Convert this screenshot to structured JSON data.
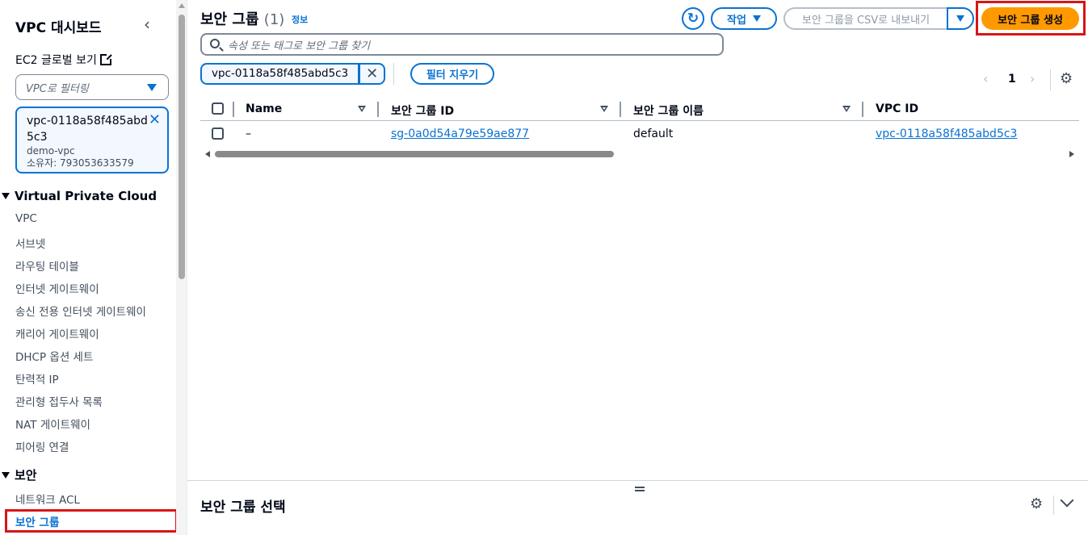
{
  "sidebar": {
    "title": "VPC 대시보드",
    "collapse_icon": "‹",
    "ec2_link": "EC2 글로벌 보기",
    "filter_placeholder": "VPC로 필터링",
    "selected_vpc": {
      "id": "vpc-0118a58f485abd5c3",
      "name": "demo-vpc",
      "owner": "소유자: 793053633579"
    },
    "section_vpc": "Virtual Private Cloud",
    "vpc_items": [
      "VPC",
      "서브넷",
      "라우팅 테이블",
      "인터넷 게이트웨이",
      "송신 전용 인터넷 게이트웨이",
      "캐리어 게이트웨이",
      "DHCP 옵션 세트",
      "탄력적 IP",
      "관리형 접두사 목록",
      "NAT 게이트웨이",
      "피어링 연결"
    ],
    "section_security": "보안",
    "security_items": [
      "네트워크 ACL",
      "보안 그룹"
    ]
  },
  "header": {
    "title": "보안 그룹",
    "count": "(1)",
    "info": "정보",
    "action_label": "작업",
    "export_label": "보안 그룹을 CSV로 내보내기",
    "create_label": "보안 그룹 생성"
  },
  "search": {
    "placeholder": "속성 또는 태그로 보안 그룹 찾기"
  },
  "filter_token": "vpc-0118a58f485abd5c3",
  "clear_filters": "필터 지우기",
  "pagination": {
    "current_page": "1",
    "prev": "‹",
    "next": "›"
  },
  "table": {
    "columns": [
      "Name",
      "보안 그룹 ID",
      "보안 그룹 이름",
      "VPC ID"
    ],
    "rows": [
      {
        "name": "–",
        "sg_id": "sg-0a0d54a79e59ae877",
        "sg_name": "default",
        "vpc_id": "vpc-0118a58f485abd5c3"
      }
    ]
  },
  "bottom_panel": {
    "title": "보안 그룹 선택"
  },
  "colors": {
    "accent": "#0972d3",
    "primary_button": "#ff9900",
    "highlight": "#d91515"
  }
}
